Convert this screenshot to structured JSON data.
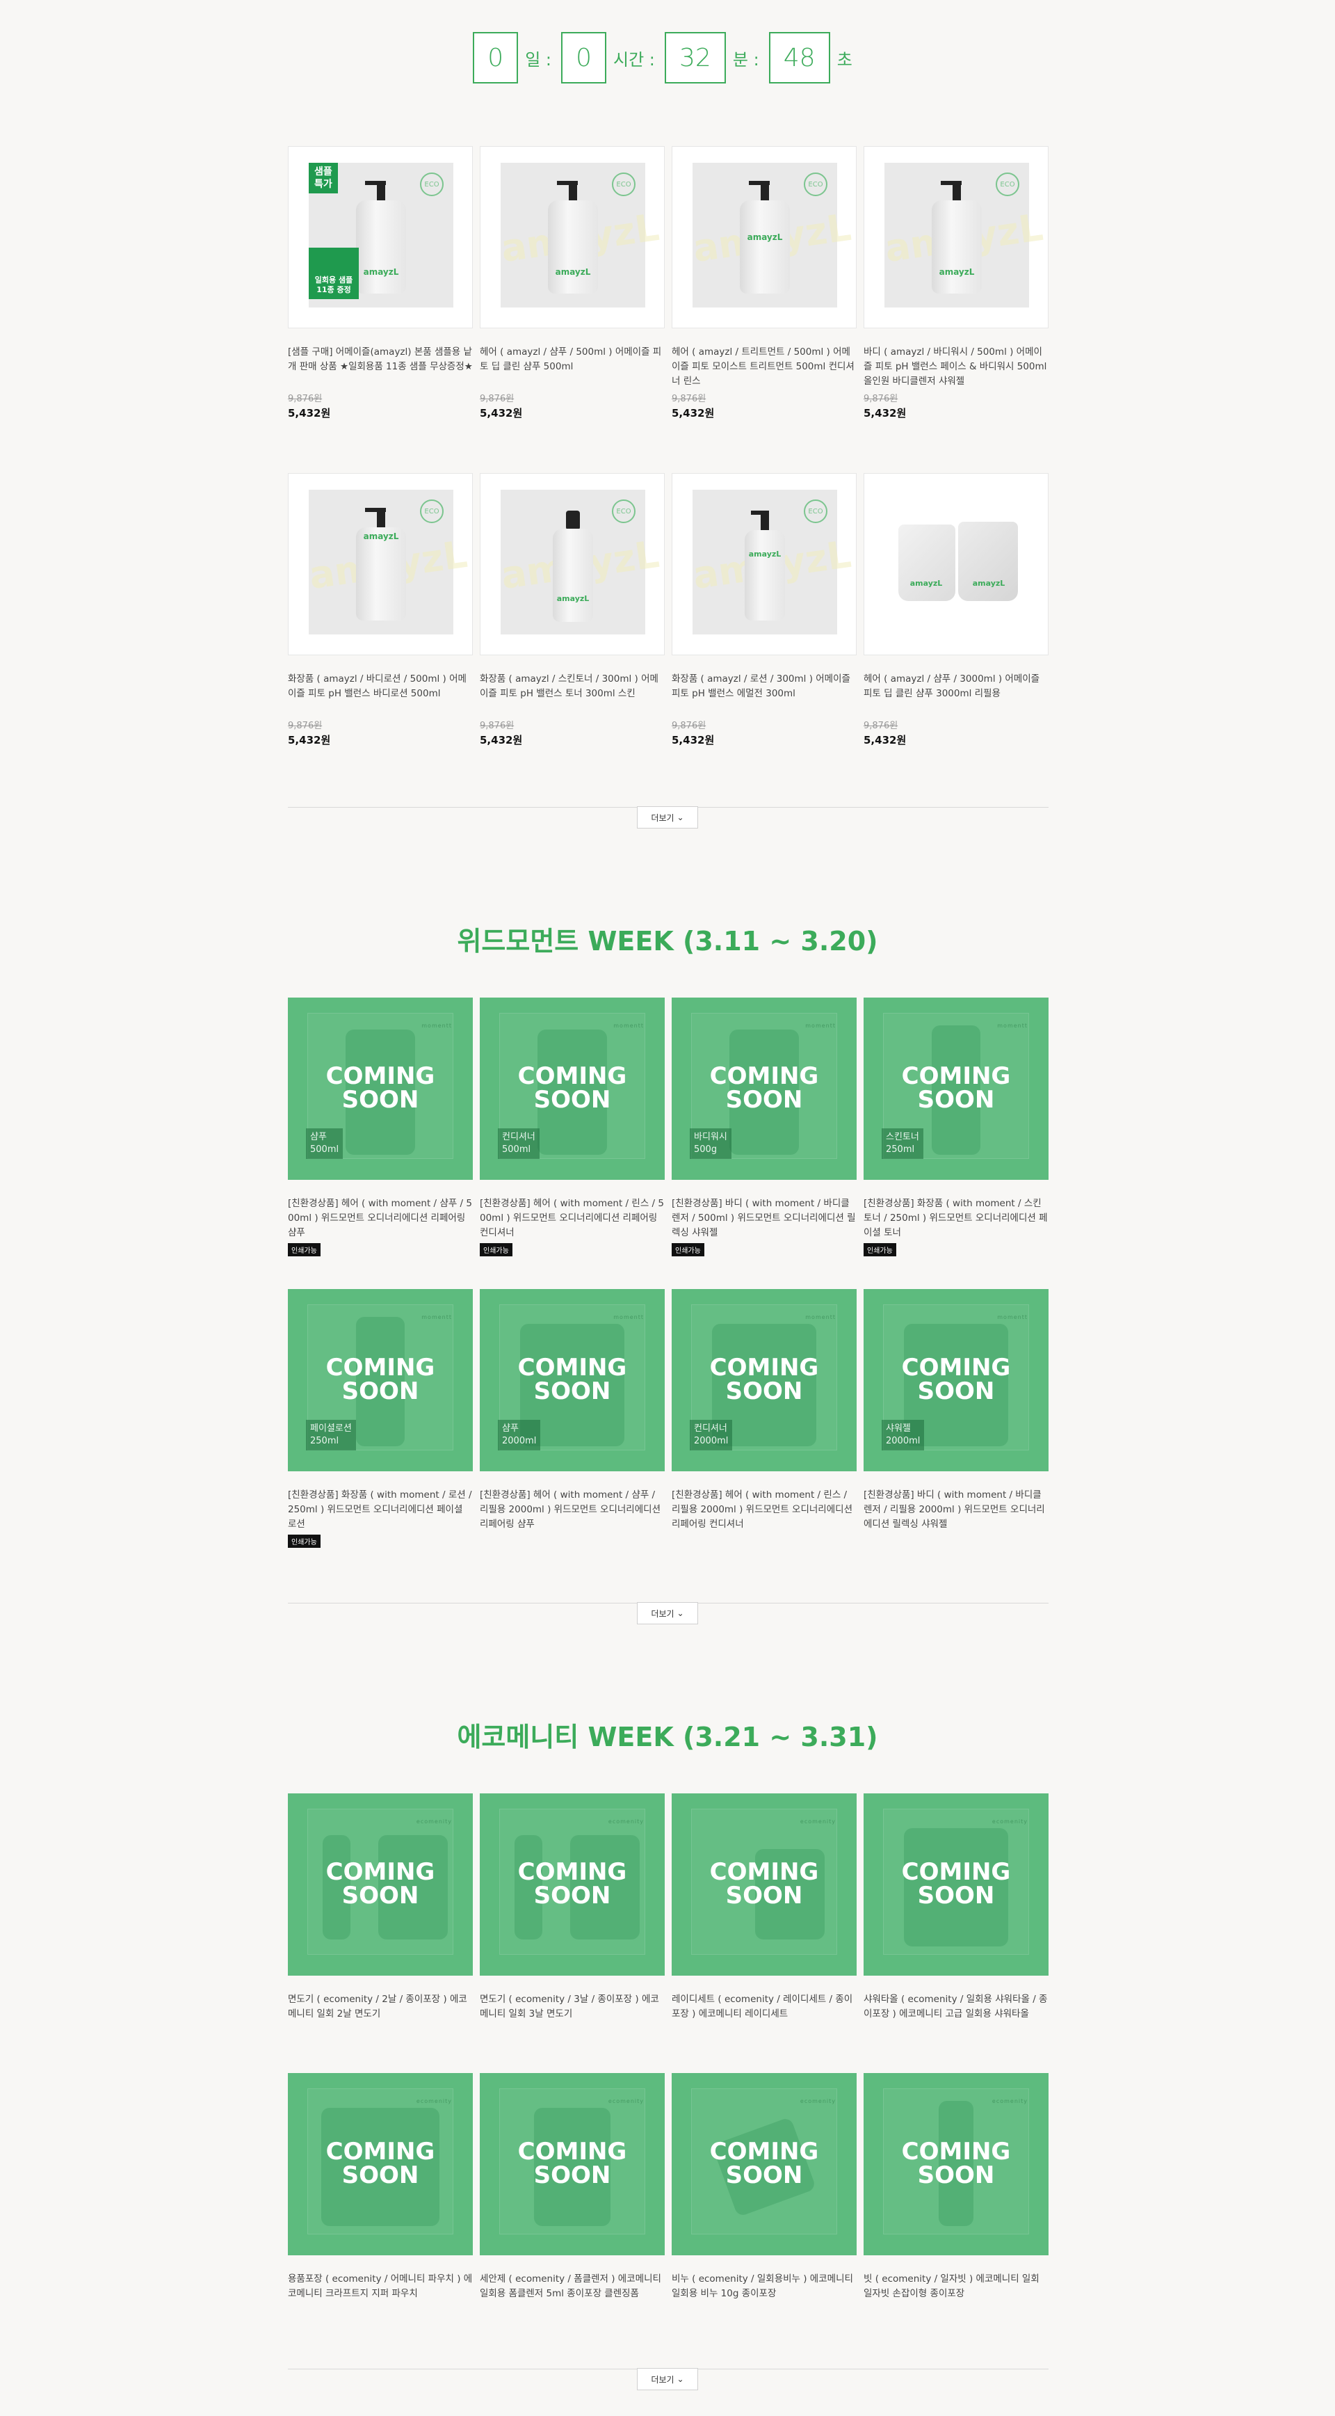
{
  "countdown": {
    "days": "0",
    "days_unit": "일 :",
    "hours": "0",
    "hours_unit": "시간 :",
    "minutes": "32",
    "minutes_unit": "분 :",
    "seconds": "48",
    "seconds_unit": "초"
  },
  "watermark": "amayzL",
  "brand_on_bottle": "amayzL",
  "seal_text": "ECO",
  "sample_badge": "샘플\n특가",
  "gift_badge": "일회용 샘플\n11종 증정",
  "products": [
    {
      "name": "[샘플 구매] 어메이즐(amayzl) 본품 샘플용 낱개 판매 상품 ★일회용품 11종 샘플 무상증정★",
      "orig": "9,876원",
      "price": "5,432원"
    },
    {
      "name": "헤어 ( amayzl / 샴푸 / 500ml ) 어메이즐 피토 딥 클린 샴푸 500ml",
      "orig": "9,876원",
      "price": "5,432원"
    },
    {
      "name": "헤어 ( amayzl / 트리트먼트 / 500ml ) 어메이즐 피토 모이스트 트리트먼트 500ml 컨디셔너 린스",
      "orig": "9,876원",
      "price": "5,432원"
    },
    {
      "name": "바디 ( amayzl / 바디워시 / 500ml ) 어메이즐 피토 pH 밸런스 페이스 & 바디워시 500ml 올인원 바디클렌저 샤워젤",
      "orig": "9,876원",
      "price": "5,432원"
    },
    {
      "name": "화장품 ( amayzl / 바디로션 / 500ml ) 어메이즐 피토 pH 밸런스 바디로션 500ml",
      "orig": "9,876원",
      "price": "5,432원"
    },
    {
      "name": "화장품 ( amayzl / 스킨토너 / 300ml ) 어메이즐 피토 pH 밸런스 토너 300ml 스킨",
      "orig": "9,876원",
      "price": "5,432원"
    },
    {
      "name": "화장품 ( amayzl / 로션 / 300ml ) 어메이즐 피토 pH 밸런스 에멀전 300ml",
      "orig": "9,876원",
      "price": "5,432원"
    },
    {
      "name": "헤어 ( amayzl / 샴푸 / 3000ml ) 어메이즐 피토 딥 클린 샴푸 3000ml 리필용",
      "orig": "9,876원",
      "price": "5,432원"
    }
  ],
  "more_label": "더보기",
  "section2": {
    "title": "위드모먼트 WEEK (3.11 ~ 3.20)",
    "coming_line1": "COMING",
    "coming_line2": "SOON",
    "brand": "momentt",
    "print_label": "인쇄가능",
    "items": [
      {
        "tag": "샴푸\n500ml",
        "name": "[친환경상품] 헤어 ( with moment / 샴푸 / 500ml ) 위드모먼트 오디너리에디션 리페어링 샴푸",
        "print": true
      },
      {
        "tag": "컨디셔너\n500ml",
        "name": "[친환경상품] 헤어 ( with moment / 린스 / 500ml ) 위드모먼트 오디너리에디션 리페어링 컨디셔너",
        "print": true
      },
      {
        "tag": "바디워시\n500g",
        "name": "[친환경상품] 바디 ( with moment / 바디클렌저 / 500ml ) 위드모먼트 오디너리에디션 릴렉싱 샤워젤",
        "print": true
      },
      {
        "tag": "스킨토너\n250ml",
        "name": "[친환경상품] 화장품 ( with moment / 스킨토너 / 250ml ) 위드모먼트 오디너리에디션 페이셜 토너",
        "print": true
      },
      {
        "tag": "페이셜로션\n250ml",
        "name": "[친환경상품] 화장품 ( with moment / 로션 / 250ml ) 위드모먼트 오디너리에디션 페이셜 로션",
        "print": true
      },
      {
        "tag": "샴푸\n2000ml",
        "name": "[친환경상품] 헤어 ( with moment / 샴푸 / 리필용 2000ml ) 위드모먼트 오디너리에디션 리페어링 샴푸",
        "print": false
      },
      {
        "tag": "컨디셔너\n2000ml",
        "name": "[친환경상품] 헤어 ( with moment / 린스 / 리필용 2000ml ) 위드모먼트 오디너리에디션 리페어링 컨디셔너",
        "print": false
      },
      {
        "tag": "샤워젤\n2000ml",
        "name": "[친환경상품] 바디 ( with moment / 바디클렌저 / 리필용 2000ml ) 위드모먼트 오디너리에디션 릴렉싱 샤워젤",
        "print": false
      }
    ]
  },
  "section3": {
    "title": "에코메니티 WEEK (3.21 ~ 3.31)",
    "coming_line1": "COMING",
    "coming_line2": "SOON",
    "brand": "ecomenity",
    "items": [
      {
        "name": "면도기 ( ecomenity / 2날 / 종이포장 ) 에코메니티 일회 2날 면도기"
      },
      {
        "name": "면도기 ( ecomenity / 3날 / 종이포장 ) 에코메니티 일회 3날 면도기"
      },
      {
        "name": "레이디세트 ( ecomenity / 레이디세트 / 종이포장 ) 에코메니티 레이디세트"
      },
      {
        "name": "샤워타올 ( ecomenity / 일회용 샤워타올 / 종이포장 ) 에코메니티 고급 일회용 샤워타올"
      },
      {
        "name": "용품포장 ( ecomenity / 어메니티 파우치 ) 에코메니티 크라프트지 지퍼 파우치"
      },
      {
        "name": "세안제 ( ecomenity / 폼클렌저 ) 에코메니티 일회용 폼클렌저 5ml 종이포장 클렌징폼"
      },
      {
        "name": "비누 ( ecomenity / 일회용비누 ) 에코메니티 일회용 비누 10g 종이포장"
      },
      {
        "name": "빗 ( ecomenity / 일자빗 ) 에코메니티 일회 일자빗 손잡이형 종이포장"
      }
    ]
  }
}
